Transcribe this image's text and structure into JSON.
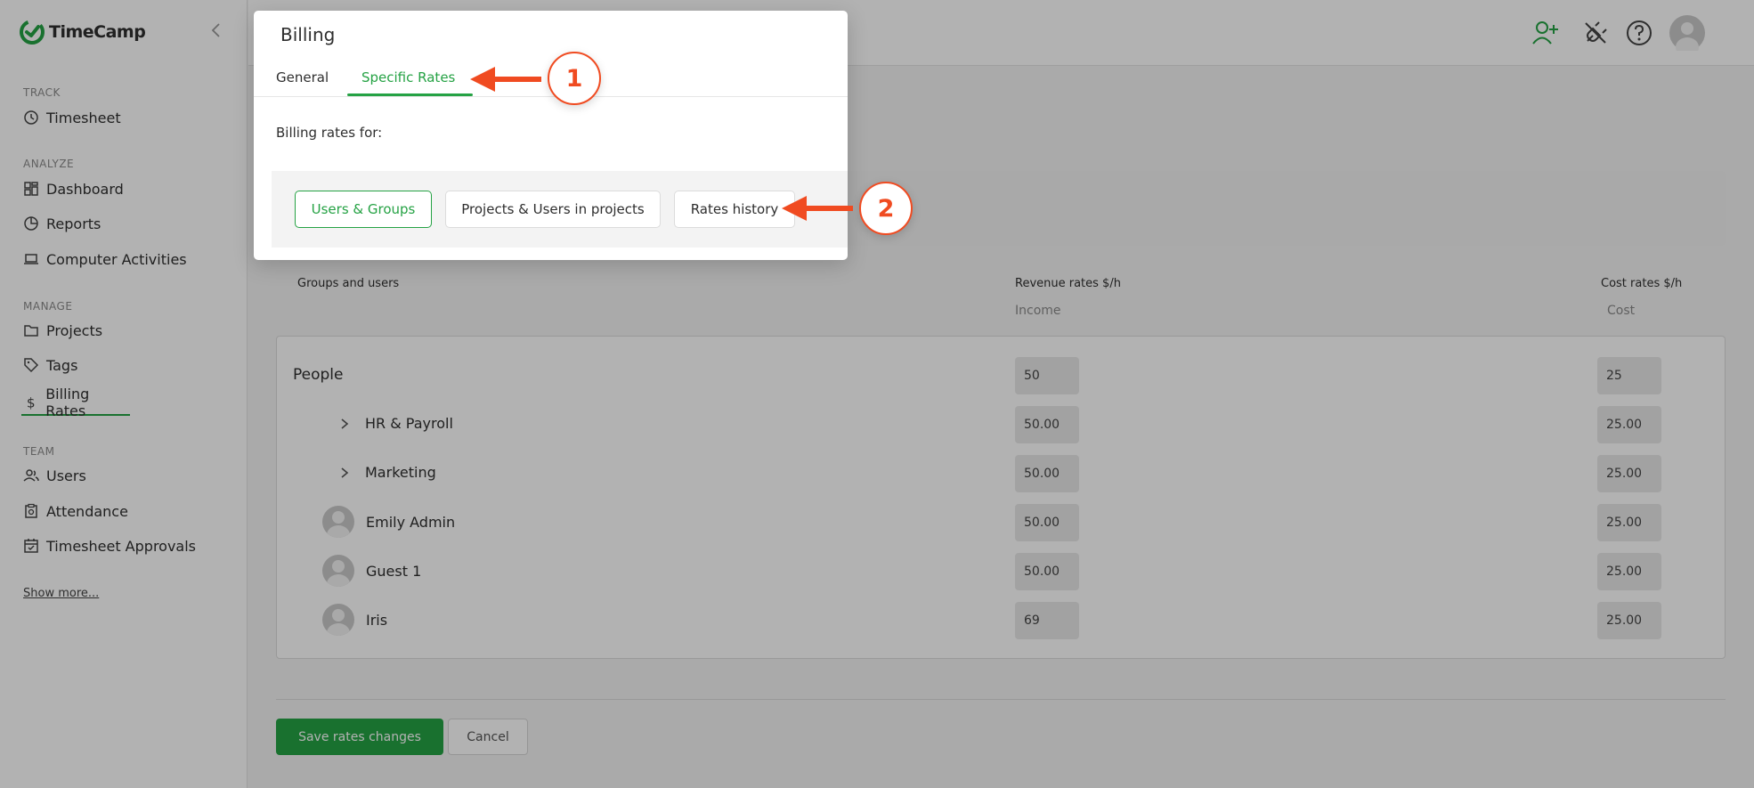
{
  "app": {
    "name": "TimeCamp",
    "brand_color": "#25a244",
    "annotation_color": "#f04b21"
  },
  "sidebar": {
    "sections": [
      {
        "label": "TRACK",
        "items": [
          {
            "label": "Timesheet",
            "icon": "clock-icon"
          }
        ]
      },
      {
        "label": "ANALYZE",
        "items": [
          {
            "label": "Dashboard",
            "icon": "dashboard-icon"
          },
          {
            "label": "Reports",
            "icon": "pie-chart-icon"
          },
          {
            "label": "Computer Activities",
            "icon": "laptop-icon"
          }
        ]
      },
      {
        "label": "MANAGE",
        "items": [
          {
            "label": "Projects",
            "icon": "folder-icon"
          },
          {
            "label": "Tags",
            "icon": "tag-icon"
          },
          {
            "label": "Billing Rates",
            "icon": "dollar-icon",
            "active": true
          }
        ]
      },
      {
        "label": "TEAM",
        "items": [
          {
            "label": "Users",
            "icon": "users-icon"
          },
          {
            "label": "Attendance",
            "icon": "clipboard-icon"
          },
          {
            "label": "Timesheet Approvals",
            "icon": "calendar-check-icon"
          }
        ]
      }
    ],
    "show_more": "Show more..."
  },
  "topbar": {
    "icons": [
      "add-user-icon",
      "plugin-icon",
      "help-icon",
      "user-avatar-icon"
    ]
  },
  "modal": {
    "title": "Billing",
    "tabs": [
      {
        "label": "General",
        "active": false
      },
      {
        "label": "Specific Rates",
        "active": true
      }
    ],
    "billing_rates_for": "Billing rates for:",
    "scope_buttons": [
      {
        "label": "Users & Groups",
        "active": true
      },
      {
        "label": "Projects & Users in projects",
        "active": false
      },
      {
        "label": "Rates history",
        "active": false
      }
    ]
  },
  "annotations": [
    {
      "number": "1"
    },
    {
      "number": "2"
    }
  ],
  "table": {
    "col_groups": "Groups and users",
    "col_revenue": "Revenue rates $/h",
    "col_revenue_sub": "Income",
    "col_cost": "Cost rates $/h",
    "col_cost_sub": "Cost",
    "rows": [
      {
        "name": "People",
        "type": "root",
        "revenue": "50",
        "cost": "25"
      },
      {
        "name": "HR & Payroll",
        "type": "group",
        "revenue": "50.00",
        "cost": "25.00"
      },
      {
        "name": "Marketing",
        "type": "group",
        "revenue": "50.00",
        "cost": "25.00"
      },
      {
        "name": "Emily Admin",
        "type": "user",
        "revenue": "50.00",
        "cost": "25.00"
      },
      {
        "name": "Guest 1",
        "type": "user",
        "revenue": "50.00",
        "cost": "25.00"
      },
      {
        "name": "Iris",
        "type": "user",
        "revenue": "69",
        "cost": "25.00"
      }
    ]
  },
  "actions": {
    "save": "Save rates changes",
    "cancel": "Cancel"
  }
}
